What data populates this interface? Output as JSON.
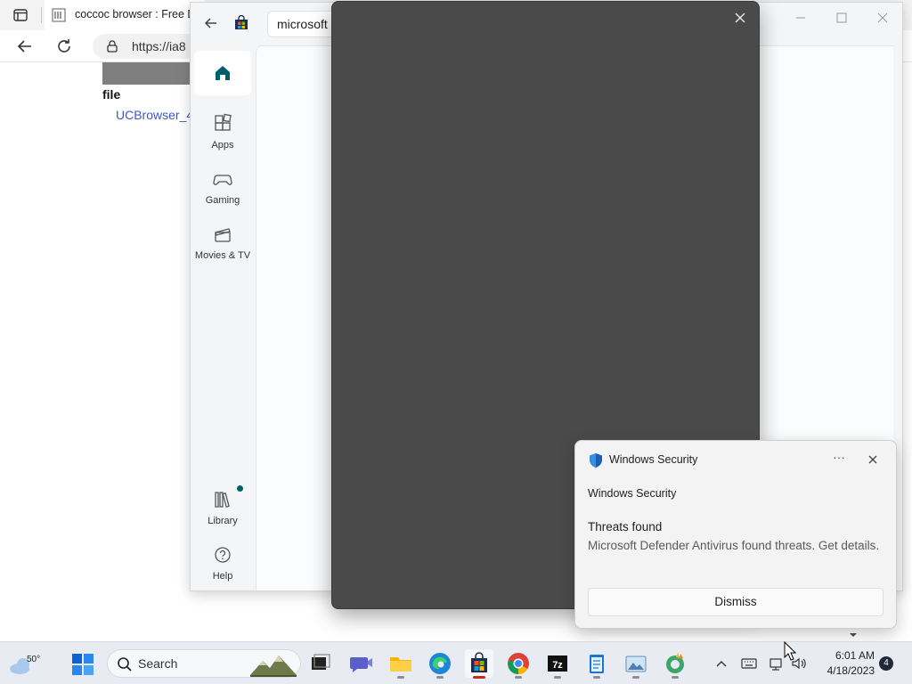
{
  "browser": {
    "tab_title": "coccoc browser : Free Do",
    "url": "https://ia8",
    "file_header": "file",
    "file_link": "UCBrowser_4"
  },
  "store": {
    "search_value": "microsoft",
    "nav": {
      "apps": "Apps",
      "gaming": "Gaming",
      "movies": "Movies & TV",
      "library": "Library",
      "help": "Help"
    }
  },
  "toast": {
    "app_name": "Windows Security",
    "more": "···",
    "source": "Windows Security",
    "title": "Threats found",
    "body": "Microsoft Defender Antivirus found threats. Get details.",
    "dismiss": "Dismiss"
  },
  "taskbar": {
    "temperature": "50°",
    "search_label": "Search",
    "time": "6:01 AM",
    "date": "4/18/2023",
    "notification_count": "4",
    "apps": [
      "task-view",
      "teams-chat",
      "file-explorer",
      "edge",
      "microsoft-store",
      "chrome",
      "7zip",
      "notepad",
      "photos",
      "coccoc"
    ],
    "active_app": "microsoft-store"
  },
  "colors": {
    "store_accent": "#006b7a",
    "dialog_bg": "#4a4a4a",
    "link": "#3e56c3",
    "active_indicator": "#c42b1c"
  }
}
